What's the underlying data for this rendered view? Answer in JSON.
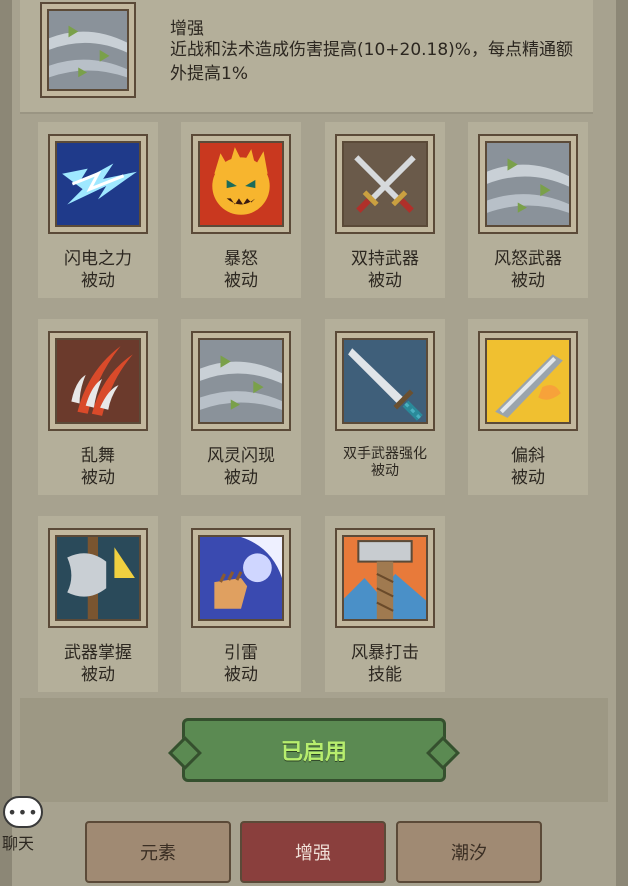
{
  "header": {
    "title": "增强",
    "description": "近战和法术造成伤害提高(10+20.18)%，每点精通额外提高1%",
    "icon": "wind-leaves-icon"
  },
  "skills": [
    {
      "name": "闪电之力",
      "type": "被动",
      "icon": "lightning-icon"
    },
    {
      "name": "暴怒",
      "type": "被动",
      "icon": "fire-face-icon"
    },
    {
      "name": "双持武器",
      "type": "被动",
      "icon": "crossed-swords-icon"
    },
    {
      "name": "风怒武器",
      "type": "被动",
      "icon": "wind-leaves-icon"
    },
    {
      "name": "乱舞",
      "type": "被动",
      "icon": "claw-slash-icon"
    },
    {
      "name": "风灵闪现",
      "type": "被动",
      "icon": "wind-leaves-icon"
    },
    {
      "name": "双手武器强化",
      "type": "被动",
      "icon": "greatsword-icon"
    },
    {
      "name": "偏斜",
      "type": "被动",
      "icon": "parry-blade-icon"
    },
    {
      "name": "武器掌握",
      "type": "被动",
      "icon": "axe-icon"
    },
    {
      "name": "引雷",
      "type": "被动",
      "icon": "lightning-fist-icon"
    },
    {
      "name": "风暴打击",
      "type": "技能",
      "icon": "storm-hammer-icon"
    }
  ],
  "activate_button": "已启用",
  "chat": {
    "label": "聊天",
    "bubble": "•••"
  },
  "tabs": [
    {
      "label": "元素",
      "active": false
    },
    {
      "label": "增强",
      "active": true
    },
    {
      "label": "潮汐",
      "active": false
    }
  ],
  "colors": {
    "background": "#8c8776",
    "panel": "#a7a28f",
    "tile": "#b4af9a",
    "frame_border": "#5b4a38",
    "active_button": "#5b8a52",
    "active_button_text": "#b7ee6e",
    "active_tab": "#8a3f3d",
    "inactive_tab": "#a08a73"
  }
}
